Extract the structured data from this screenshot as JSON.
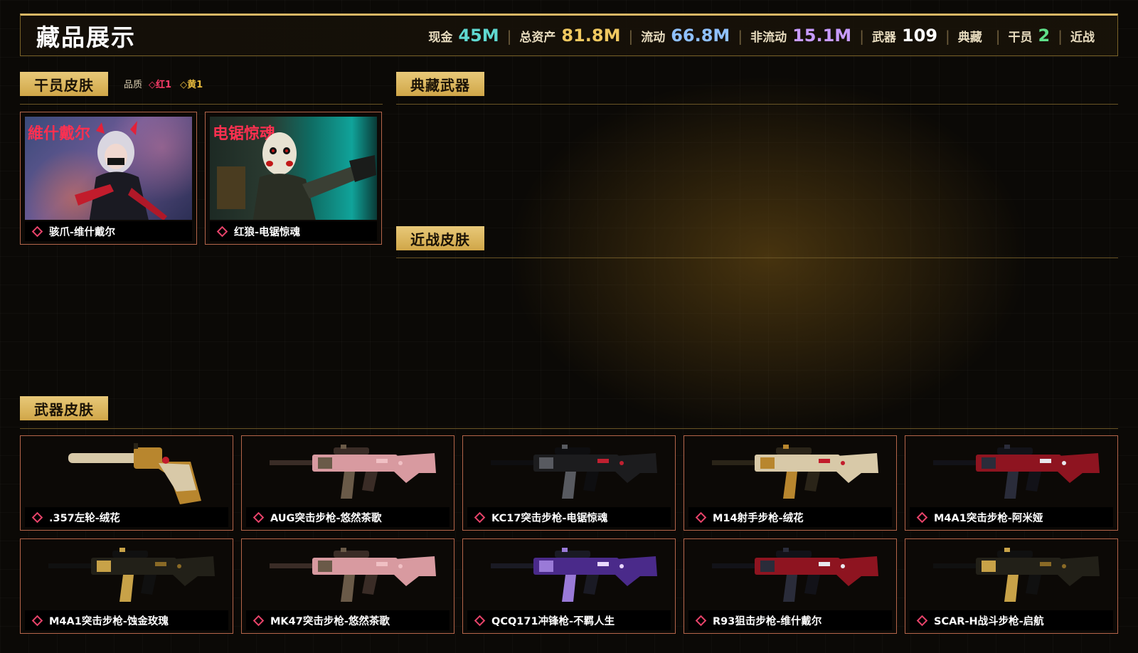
{
  "header": {
    "title": "藏品展示",
    "stats": [
      {
        "label": "现金",
        "value": "45M",
        "color": "#5fd8d0"
      },
      {
        "label": "总资产",
        "value": "81.8M",
        "color": "#f0c860"
      },
      {
        "label": "流动",
        "value": "66.8M",
        "color": "#8fc0ff"
      },
      {
        "label": "非流动",
        "value": "15.1M",
        "color": "#c79bff"
      },
      {
        "label": "武器",
        "value": "109",
        "color": "#ffffff"
      },
      {
        "label": "典藏",
        "value": "",
        "color": "#ffffff"
      },
      {
        "label": "干员",
        "value": "2",
        "color": "#5fe08a"
      },
      {
        "label": "近战",
        "value": "",
        "color": "#ffffff"
      }
    ]
  },
  "operator_section": {
    "title": "干员皮肤",
    "quality_label": "品质",
    "quality_red": "红1",
    "quality_yellow": "黄1",
    "items": [
      {
        "name": "骇爪-维什戴尔",
        "art_text": "維什戴尔"
      },
      {
        "name": "红狼-电锯惊魂",
        "art_text": "电锯惊魂"
      }
    ]
  },
  "collection_section": {
    "title": "典藏武器"
  },
  "melee_section": {
    "title": "近战皮肤"
  },
  "weapon_section": {
    "title": "武器皮肤",
    "items": [
      {
        "name": ".357左轮-绒花",
        "palette": "gold"
      },
      {
        "name": "AUG突击步枪-悠然茶歌",
        "palette": "pink"
      },
      {
        "name": "KC17突击步枪-电锯惊魂",
        "palette": "dark"
      },
      {
        "name": "M14射手步枪-绒花",
        "palette": "gold"
      },
      {
        "name": "M4A1突击步枪-阿米娅",
        "palette": "red"
      },
      {
        "name": "M4A1突击步枪-蚀金玫瑰",
        "palette": "goldblack"
      },
      {
        "name": "MK47突击步枪-悠然茶歌",
        "palette": "pink"
      },
      {
        "name": "QCQ171冲锋枪-不羁人生",
        "palette": "purple"
      },
      {
        "name": "R93狙击步枪-维什戴尔",
        "palette": "red"
      },
      {
        "name": "SCAR-H战斗步枪-启航",
        "palette": "goldblack"
      }
    ]
  }
}
